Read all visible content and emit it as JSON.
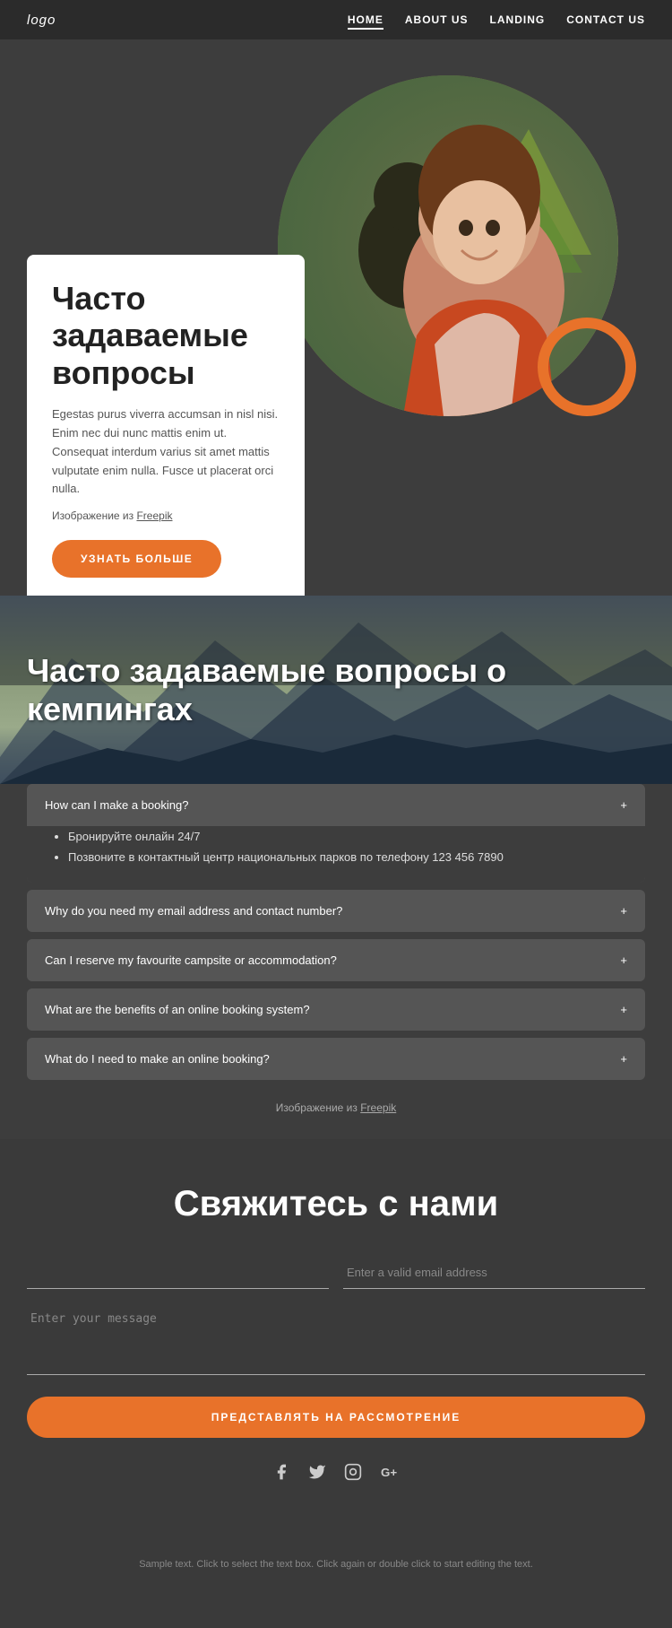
{
  "nav": {
    "logo": "logo",
    "links": [
      {
        "label": "HOME",
        "href": "#",
        "active": true
      },
      {
        "label": "ABOUT US",
        "href": "#",
        "active": false
      },
      {
        "label": "LANDING",
        "href": "#",
        "active": false
      },
      {
        "label": "CONTACT US",
        "href": "#",
        "active": false
      }
    ]
  },
  "hero": {
    "title": "Часто задаваемые вопросы",
    "body": "Egestas purus viverra accumsan in nisl nisi. Enim nec dui nunc mattis enim ut. Consequat interdum varius sit amet mattis vulputate enim nulla. Fusce ut placerat orci nulla.",
    "source_text": "Изображение из ",
    "source_link_label": "Freepik",
    "cta_label": "УЗНАТЬ БОЛЬШЕ"
  },
  "faq_banner": {
    "title": "Часто задаваемые вопросы о кемпингах"
  },
  "faq_items": [
    {
      "question": "How can I make a booking?",
      "expanded": true,
      "answer_items": [
        "Бронируйте онлайн 24/7",
        "Позвоните в контактный центр национальных парков по телефону 123 456 7890"
      ]
    },
    {
      "question": "Why do you need my email address and contact number?",
      "expanded": false,
      "answer_items": []
    },
    {
      "question": "Can I reserve my favourite campsite or accommodation?",
      "expanded": false,
      "answer_items": []
    },
    {
      "question": "What are the benefits of an online booking system?",
      "expanded": false,
      "answer_items": []
    },
    {
      "question": "What do I need to make an online booking?",
      "expanded": false,
      "answer_items": []
    }
  ],
  "faq_source": {
    "text": "Изображение из ",
    "link_label": "Freepik"
  },
  "contact": {
    "title": "Свяжитесь с нами",
    "name_placeholder": "",
    "email_placeholder": "Enter a valid email address",
    "message_placeholder": "Enter your message",
    "submit_label": "ПРЕДСТАВЛЯТЬ НА РАССМОТРЕНИЕ"
  },
  "social": {
    "icons": [
      "f",
      "t",
      "ig",
      "g+"
    ]
  },
  "footer": {
    "text": "Sample text. Click to select the text box. Click again or double click to start editing the text."
  }
}
